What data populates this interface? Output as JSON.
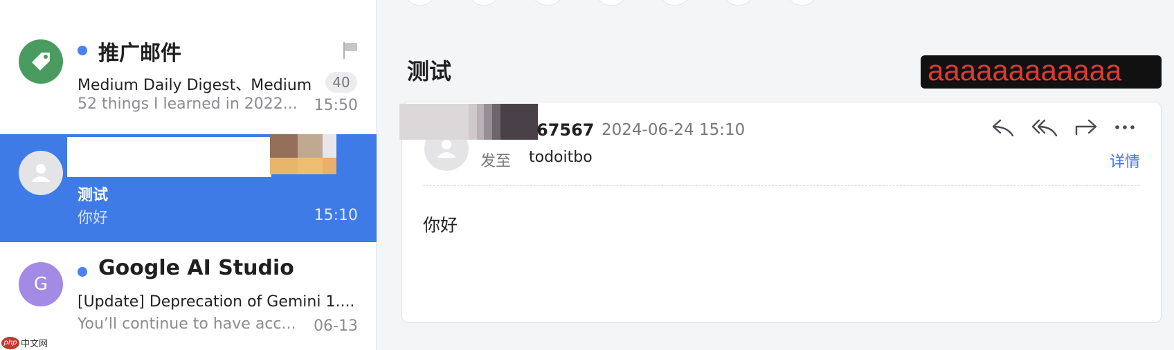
{
  "mail_list": {
    "items": [
      {
        "sender": "推广邮件",
        "subject": "Medium Daily Digest、Medium",
        "preview": "52 things I learned in 2022...",
        "time": "15:50",
        "count": "40",
        "unread": true,
        "avatar_icon": "tag-icon",
        "flag_icon": "flag-icon"
      },
      {
        "sender": "",
        "subject": "测试",
        "preview": "你好",
        "time": "15:10",
        "selected": true,
        "avatar_icon": "person-icon"
      },
      {
        "sender": "Google AI Studio",
        "subject": "[Update] Deprecation of Gemini 1....",
        "preview": "You’ll continue to have acc...",
        "time": "06-13",
        "unread": true,
        "avatar_letter": "G"
      }
    ]
  },
  "reading_pane": {
    "title": "测试",
    "badge_text": "aaaaaaaaaaaa",
    "message": {
      "sender_name": "67567",
      "datetime": "2024-06-24 15:10",
      "to_label": "发至",
      "to_value": "todoitbo",
      "details_label": "详情",
      "body": "你好",
      "actions": [
        "reply-icon",
        "reply-all-icon",
        "forward-icon",
        "more-icon"
      ]
    }
  },
  "watermark": {
    "logo_text": "php",
    "text": "中文网"
  },
  "colors": {
    "selected_row": "#3f7be6",
    "unread_dot": "#4a82ef",
    "link": "#3d7be4",
    "badge_text": "#e03a2f",
    "promo_avatar": "#4a9b5f",
    "google_avatar": "#a28ae5"
  }
}
